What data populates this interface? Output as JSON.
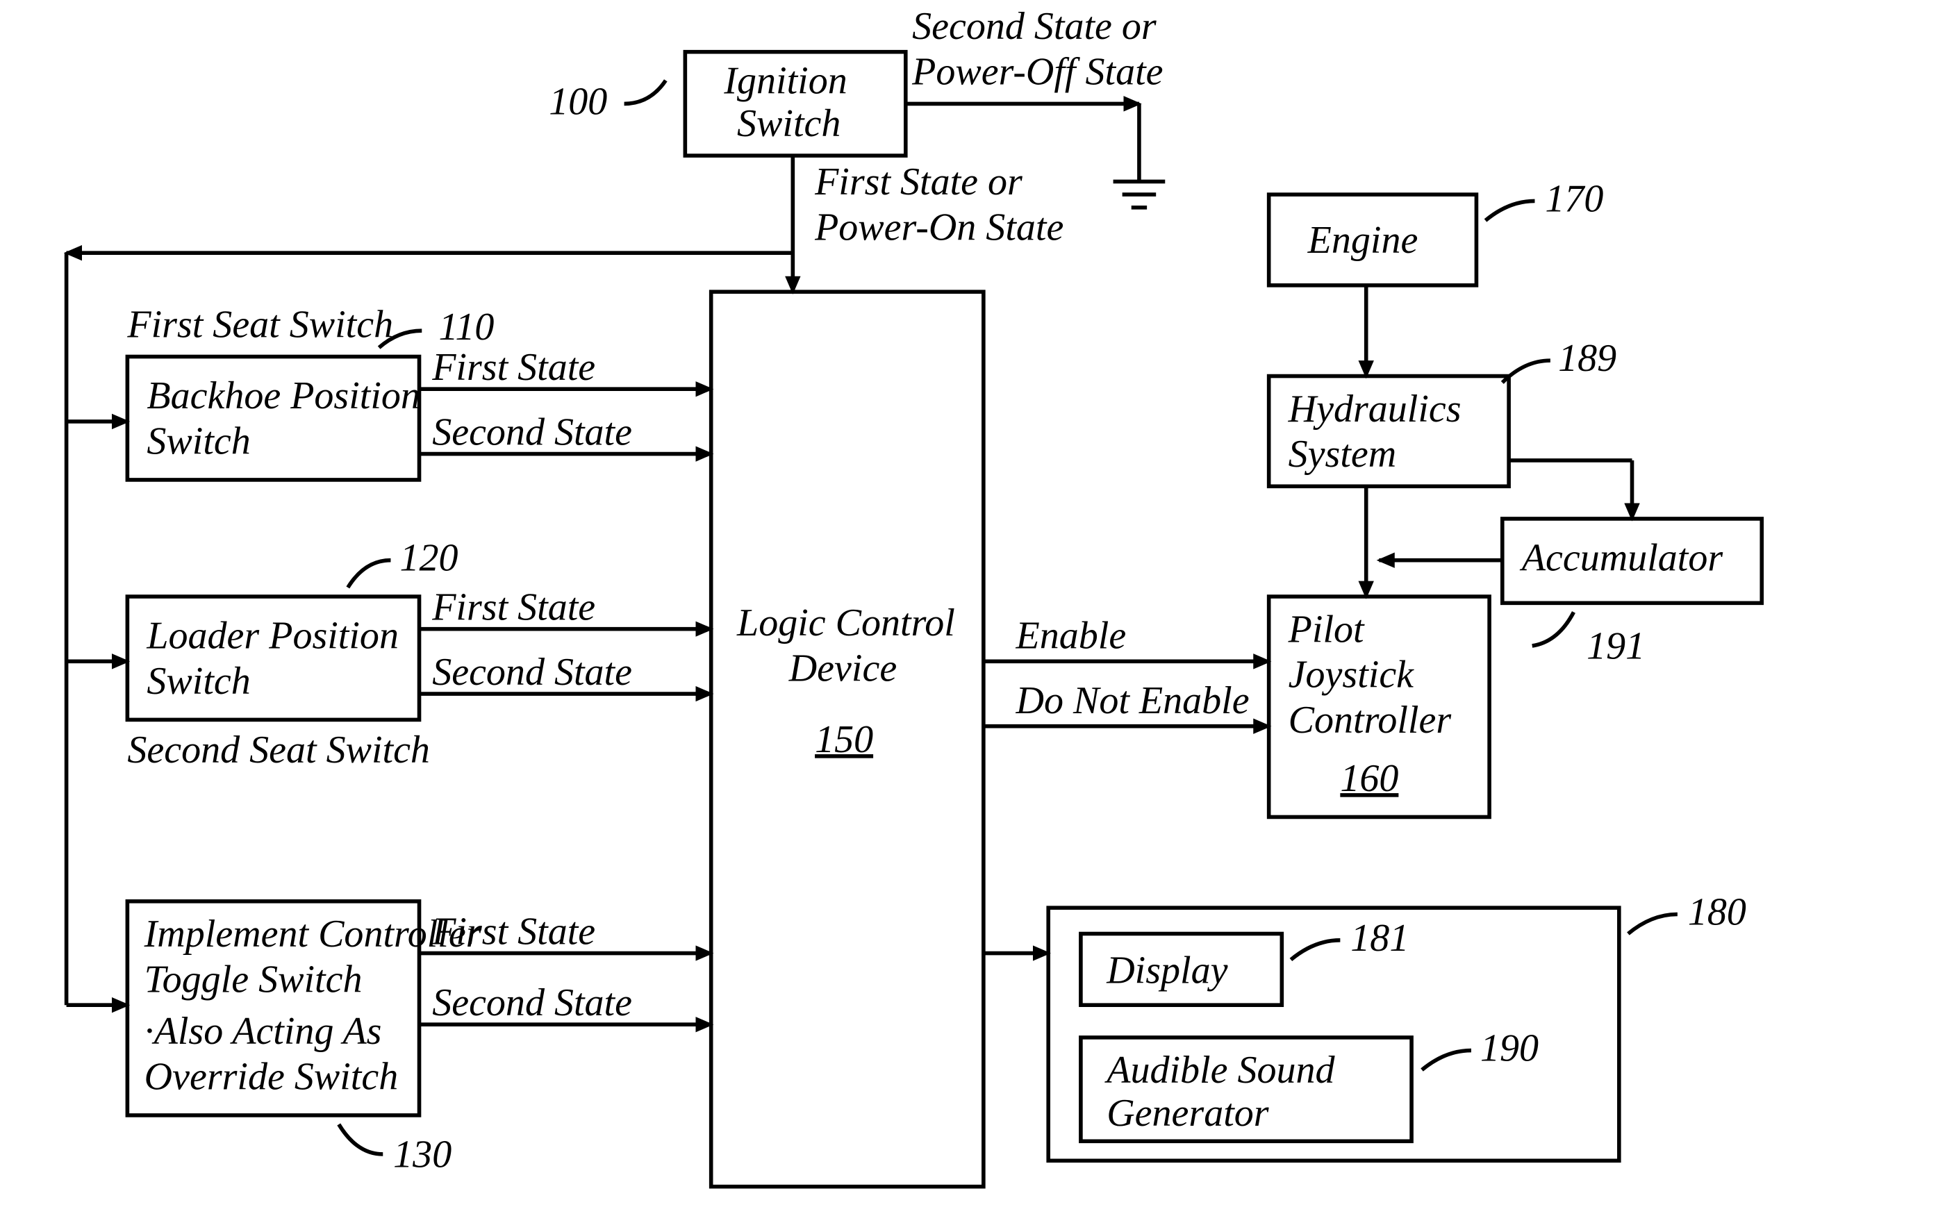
{
  "refs": {
    "r100": "100",
    "r110": "110",
    "r120": "120",
    "r130": "130",
    "r150": "150",
    "r160": "160",
    "r170": "170",
    "r180": "180",
    "r181": "181",
    "r189": "189",
    "r190": "190",
    "r191": "191"
  },
  "boxes": {
    "ignition": "Ignition",
    "ignition2": "Switch",
    "backhoe1": "Backhoe Position",
    "backhoe2": "Switch",
    "loader1": "Loader Position",
    "loader2": "Switch",
    "impl1": "Implement Controller",
    "impl2": "Toggle Switch",
    "impl3": "·Also Acting As",
    "impl4": "Override Switch",
    "logic1": "Logic Control",
    "logic2": "Device",
    "engine": "Engine",
    "hyd1": "Hydraulics",
    "hyd2": "System",
    "accum": "Accumulator",
    "pilot1": "Pilot",
    "pilot2": "Joystick",
    "pilot3": "Controller",
    "display": "Display",
    "asg1": "Audible Sound",
    "asg2": "Generator"
  },
  "labels": {
    "firstSeat": "First Seat Switch",
    "secondSeat": "Second Seat Switch",
    "firstState": "First State",
    "secondState": "Second State",
    "enable": "Enable",
    "doNotEnable": "Do Not Enable",
    "powOn1": "First State or",
    "powOn2": "Power-On State",
    "powOff1": "Second State or",
    "powOff2": "Power-Off State"
  }
}
